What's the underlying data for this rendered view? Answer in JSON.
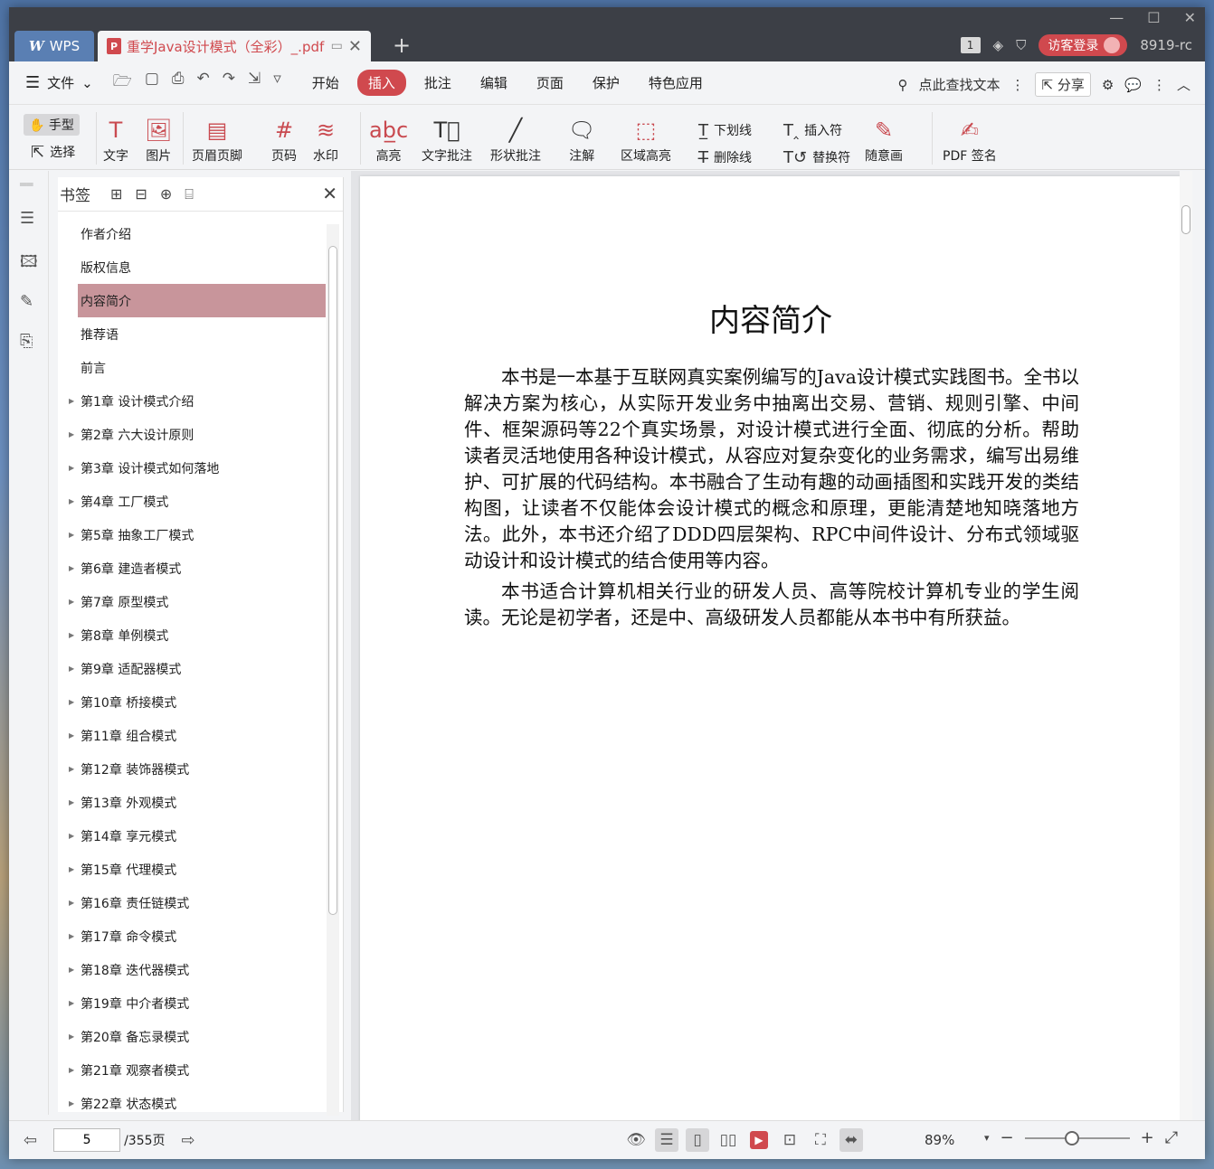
{
  "titlebar": {
    "wps_tab": "WPS",
    "doc_tab_title": "重学Java设计模式（全彩）_.pdf",
    "page_badge": "1",
    "guest_login": "访客登录",
    "user_id": "8919-rc"
  },
  "menubar": {
    "file": "文件",
    "tabs": [
      "开始",
      "插入",
      "批注",
      "编辑",
      "页面",
      "保护",
      "特色应用"
    ],
    "active_tab": "插入",
    "search_text": "点此查找文本",
    "share": "分享"
  },
  "ribbon": {
    "hand": "手型",
    "select": "选择",
    "text": "文字",
    "image": "图片",
    "header_footer": "页眉页脚",
    "page_number": "页码",
    "watermark": "水印",
    "highlight": "高亮",
    "text_comment": "文字批注",
    "shape_comment": "形状批注",
    "annotation": "注解",
    "area_highlight": "区域高亮",
    "underline": "下划线",
    "strikethrough": "删除线",
    "insert_mark": "插入符",
    "replace_mark": "替换符",
    "freehand": "随意画",
    "pdf_sign": "PDF 签名"
  },
  "bookmarks": {
    "title": "书签",
    "items": [
      {
        "label": "作者介绍",
        "expandable": false
      },
      {
        "label": "版权信息",
        "expandable": false
      },
      {
        "label": "内容简介",
        "expandable": false,
        "selected": true
      },
      {
        "label": "推荐语",
        "expandable": false
      },
      {
        "label": "前言",
        "expandable": false
      },
      {
        "label": "第1章 设计模式介绍",
        "expandable": true
      },
      {
        "label": "第2章 六大设计原则",
        "expandable": true
      },
      {
        "label": "第3章 设计模式如何落地",
        "expandable": true
      },
      {
        "label": "第4章 工厂模式",
        "expandable": true
      },
      {
        "label": "第5章 抽象工厂模式",
        "expandable": true
      },
      {
        "label": "第6章 建造者模式",
        "expandable": true
      },
      {
        "label": "第7章 原型模式",
        "expandable": true
      },
      {
        "label": "第8章 单例模式",
        "expandable": true
      },
      {
        "label": "第9章 适配器模式",
        "expandable": true
      },
      {
        "label": "第10章 桥接模式",
        "expandable": true
      },
      {
        "label": "第11章 组合模式",
        "expandable": true
      },
      {
        "label": "第12章 装饰器模式",
        "expandable": true
      },
      {
        "label": "第13章 外观模式",
        "expandable": true
      },
      {
        "label": "第14章 享元模式",
        "expandable": true
      },
      {
        "label": "第15章 代理模式",
        "expandable": true
      },
      {
        "label": "第16章 责任链模式",
        "expandable": true
      },
      {
        "label": "第17章 命令模式",
        "expandable": true
      },
      {
        "label": "第18章 迭代器模式",
        "expandable": true
      },
      {
        "label": "第19章 中介者模式",
        "expandable": true
      },
      {
        "label": "第20章 备忘录模式",
        "expandable": true
      },
      {
        "label": "第21章 观察者模式",
        "expandable": true
      },
      {
        "label": "第22章 状态模式",
        "expandable": true
      }
    ]
  },
  "document": {
    "title": "内容简介",
    "paragraphs": [
      "本书是一本基于互联网真实案例编写的Java设计模式实践图书。全书以解决方案为核心，从实际开发业务中抽离出交易、营销、规则引擎、中间件、框架源码等22个真实场景，对设计模式进行全面、彻底的分析。帮助读者灵活地使用各种设计模式，从容应对复杂变化的业务需求，编写出易维护、可扩展的代码结构。本书融合了生动有趣的动画插图和实践开发的类结构图，让读者不仅能体会设计模式的概念和原理，更能清楚地知晓落地方法。此外，本书还介绍了DDD四层架构、RPC中间件设计、分布式领域驱动设计和设计模式的结合使用等内容。",
      "本书适合计算机相关行业的研发人员、高等院校计算机专业的学生阅读。无论是初学者，还是中、高级研发人员都能从本书中有所获益。"
    ]
  },
  "statusbar": {
    "current_page": "5",
    "total_pages": "/355页",
    "zoom": "89%",
    "zoom_level": 0.89
  },
  "colors": {
    "accent": "#d0494e",
    "bookmark_selected": "#c8959b",
    "titlebar": "#3c3f46"
  }
}
